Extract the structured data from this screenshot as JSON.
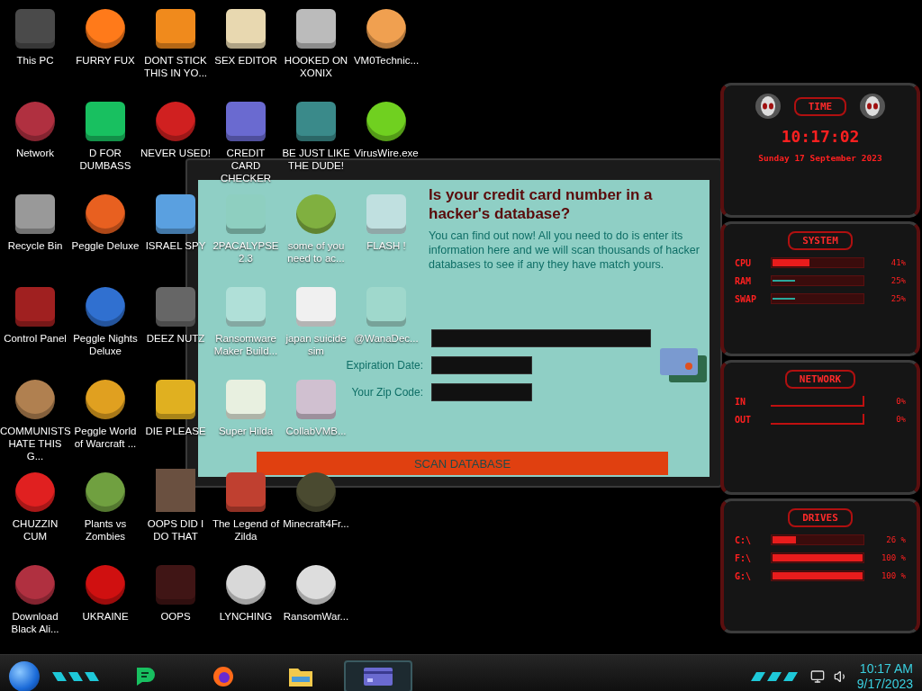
{
  "desktop_icons": [
    [
      {
        "label": "This PC",
        "kind": "tile",
        "color": "#4a4a4a"
      },
      {
        "label": "FURRY FUX",
        "kind": "round",
        "color": "#ff7a1a"
      },
      {
        "label": "DONT STICK THIS IN YO...",
        "kind": "tile",
        "color": "#f08a1c"
      },
      {
        "label": "SEX EDITOR",
        "kind": "tile",
        "color": "#e8d8b0"
      },
      {
        "label": "HOOKED ON XONIX",
        "kind": "tile",
        "color": "#bbbbbb"
      },
      {
        "label": "VM0Technic...",
        "kind": "round",
        "color": "#f0a050"
      }
    ],
    [
      {
        "label": "Network",
        "kind": "round",
        "color": "#b03040"
      },
      {
        "label": "D FOR DUMBASS",
        "kind": "tile",
        "color": "#18c060"
      },
      {
        "label": "NEVER USED!",
        "kind": "round",
        "color": "#d02020"
      },
      {
        "label": "CREDIT CARD CHECKER",
        "kind": "tile",
        "color": "#6a6ad0"
      },
      {
        "label": "BE JUST LIKE THE DUDE!",
        "kind": "tile",
        "color": "#3a8a8a"
      },
      {
        "label": "VirusWire.exe",
        "kind": "round",
        "color": "#70d020"
      }
    ],
    [
      {
        "label": "Recycle Bin",
        "kind": "tile",
        "color": "#999999"
      },
      {
        "label": "Peggle Deluxe",
        "kind": "round",
        "color": "#e86020"
      },
      {
        "label": "ISRAEL SPY",
        "kind": "tile",
        "color": "#5aa0e0"
      },
      {
        "label": "2PACALYPSE 2.3",
        "kind": "tile",
        "color": "#8ecfc0"
      },
      {
        "label": "some of you need to ac...",
        "kind": "round",
        "color": "#80b040"
      },
      {
        "label": "FLASH !",
        "kind": "tile",
        "color": "#c0e0e0"
      }
    ],
    [
      {
        "label": "Control Panel",
        "kind": "tile",
        "color": "#a02020"
      },
      {
        "label": "Peggle Nights Deluxe",
        "kind": "round",
        "color": "#3070d0"
      },
      {
        "label": "DEEZ NUTZ",
        "kind": "tile",
        "color": "#666666"
      },
      {
        "label": "Ransomware Maker Build...",
        "kind": "tile",
        "color": "#b0e0d8"
      },
      {
        "label": "japan suicide sim",
        "kind": "tile",
        "color": "#f0f0f0"
      },
      {
        "label": "@WanaDec...",
        "kind": "tile",
        "color": "#9fd8cc"
      }
    ],
    [
      {
        "label": "COMMUNISTS HATE THIS G...",
        "kind": "round",
        "color": "#b08050"
      },
      {
        "label": "Peggle World of Warcraft ...",
        "kind": "round",
        "color": "#e0a020"
      },
      {
        "label": "DIE PLEASE",
        "kind": "tile",
        "color": "#e0b020"
      },
      {
        "label": "Super Hilda",
        "kind": "tile",
        "color": "#e8f0e0"
      },
      {
        "label": "CollabVMB...",
        "kind": "tile",
        "color": "#d0c0d0"
      }
    ],
    [
      {
        "label": "CHUZZIN CUM",
        "kind": "round",
        "color": "#e02020"
      },
      {
        "label": "Plants vs Zombies",
        "kind": "round",
        "color": "#70a040"
      },
      {
        "label": "OOPS DID I DO THAT",
        "kind": "photo",
        "color": "#6a5040"
      },
      {
        "label": "The Legend of Zilda",
        "kind": "tile",
        "color": "#c04030"
      },
      {
        "label": "Minecraft4Fr...",
        "kind": "round",
        "color": "#4a4a30"
      }
    ],
    [
      {
        "label": "Download Black Ali...",
        "kind": "round",
        "color": "#b03040"
      },
      {
        "label": "UKRAINE",
        "kind": "round",
        "color": "#d01010"
      },
      {
        "label": "OOPS",
        "kind": "tile",
        "color": "#401515"
      },
      {
        "label": "LYNCHING",
        "kind": "round",
        "color": "#d8d8d8"
      },
      {
        "label": "RansomWar...",
        "kind": "round",
        "color": "#dddddd"
      }
    ]
  ],
  "dialog": {
    "heading": "Is your credit card number in a hacker's database?",
    "description": "You can find out now! All you need to do is enter its information here and we will scan thousands of hacker databases to see if any they have match yours.",
    "fields": [
      {
        "kind": "wide"
      },
      {
        "label": "Expiration Date:",
        "kind": "short"
      },
      {
        "label": "Your Zip Code:",
        "kind": "short"
      }
    ],
    "button": "SCAN DATABASE"
  },
  "gadget": {
    "time": {
      "title": "TIME",
      "clock": "10:17:02",
      "date": "Sunday 17 September 2023"
    },
    "system": {
      "title": "SYSTEM",
      "rows": [
        {
          "label": "CPU",
          "kind": "chevrons",
          "level": 0.41,
          "reading": "41%"
        },
        {
          "label": "RAM",
          "kind": "line",
          "level": 0.25,
          "reading": "25%"
        },
        {
          "label": "SWAP",
          "kind": "line",
          "level": 0.25,
          "reading": "25%"
        }
      ]
    },
    "network": {
      "title": "NETWORK",
      "rows": [
        {
          "label": "IN",
          "reading": "0%"
        },
        {
          "label": "OUT",
          "reading": "0%"
        }
      ]
    },
    "drives": {
      "title": "DRIVES",
      "rows": [
        {
          "label": "C:\\",
          "kind": "chevrons",
          "level": 0.26,
          "reading": "26 %"
        },
        {
          "label": "F:\\",
          "kind": "chevrons",
          "level": 1,
          "reading": "100 %"
        },
        {
          "label": "G:\\",
          "kind": "chevrons",
          "level": 1,
          "reading": "100 %"
        }
      ]
    }
  },
  "taskbar": {
    "apps": [
      {
        "kind": "notes",
        "selected": false
      },
      {
        "kind": "browser",
        "selected": false
      },
      {
        "kind": "folder",
        "selected": false
      },
      {
        "kind": "card",
        "selected": true
      }
    ],
    "time": "10:17 AM",
    "date": "9/17/2023"
  }
}
